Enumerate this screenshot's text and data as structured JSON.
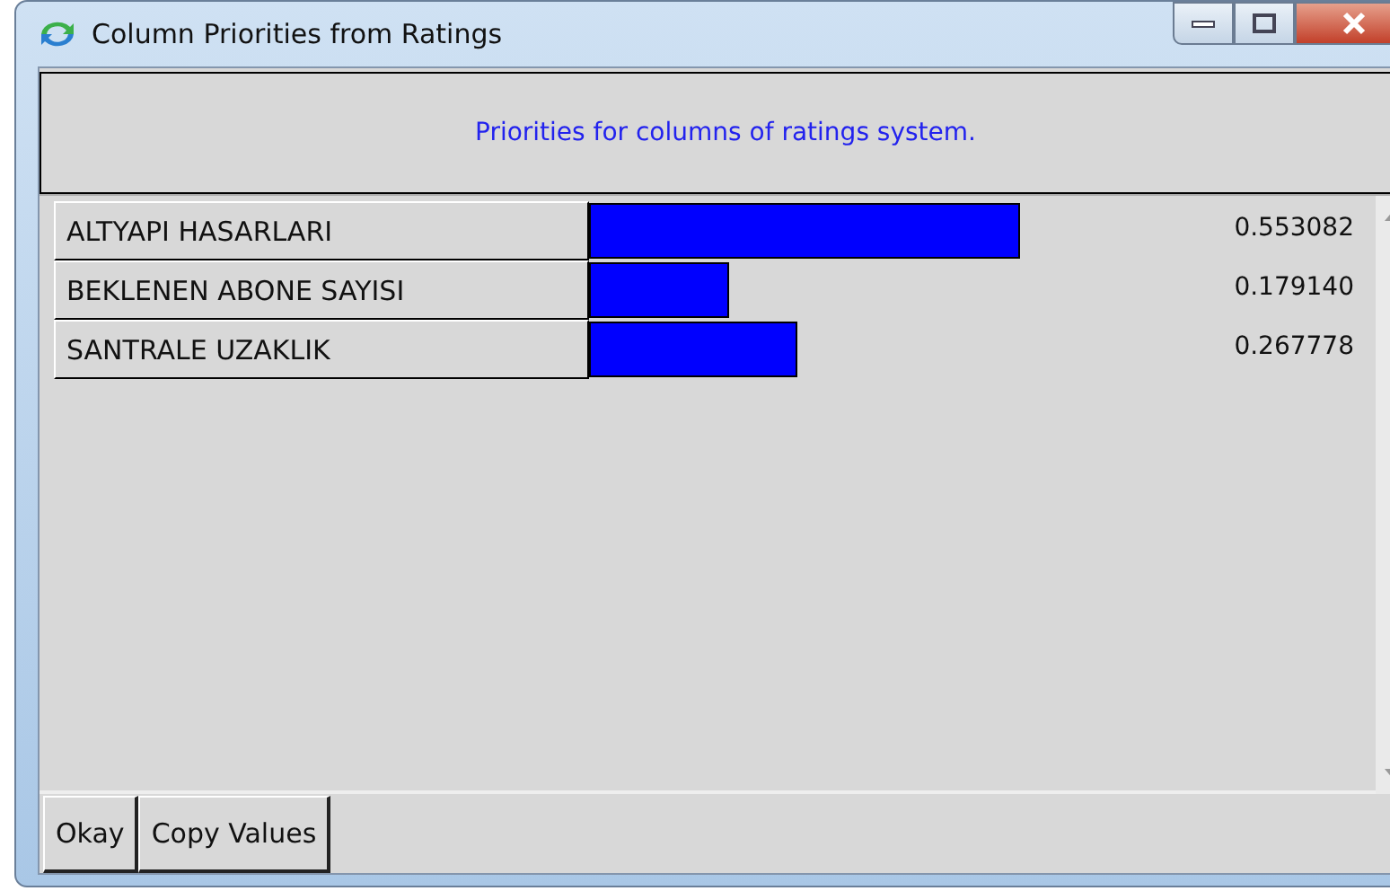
{
  "window": {
    "title": "Column Priorities from Ratings"
  },
  "header": {
    "text": "Priorities for columns of ratings system."
  },
  "rows": [
    {
      "name": "ALTYAPI HASARLARI",
      "reading": "0.553082"
    },
    {
      "name": "BEKLENEN ABONE SAYISI",
      "reading": "0.179140"
    },
    {
      "name": "SANTRALE UZAKLIK",
      "reading": "0.267778"
    }
  ],
  "buttons": [
    "Okay",
    "Copy Values"
  ]
}
